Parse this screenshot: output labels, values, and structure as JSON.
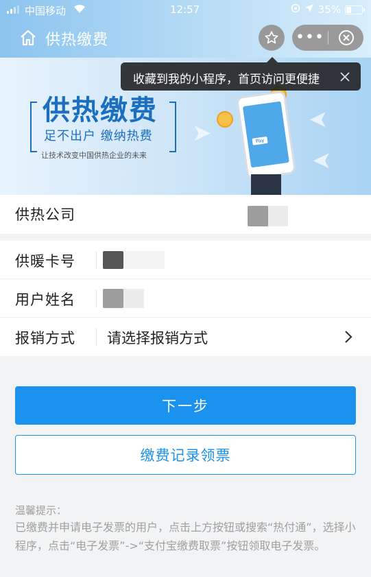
{
  "status_bar": {
    "carrier": "中国移动",
    "time": "12:57",
    "battery": "35%"
  },
  "nav": {
    "title": "供热缴费",
    "more": "•••"
  },
  "tooltip": {
    "text": "收藏到我的小程序，首页访问更便捷"
  },
  "banner": {
    "title": "供热缴费",
    "subtitle": "足不出户  缴纳热费",
    "slogan": "让技术改变中国供热企业的未来",
    "phone_label": "Pay"
  },
  "form": {
    "rows": [
      {
        "label": "供热公司",
        "value": ""
      },
      {
        "label": "供暖卡号",
        "value": ""
      },
      {
        "label": "用户姓名",
        "value": ""
      },
      {
        "label": "报销方式",
        "value": "请选择报销方式"
      }
    ]
  },
  "buttons": {
    "next": "下一步",
    "records": "缴费记录领票"
  },
  "tips": {
    "title": "温馨提示：",
    "body": "已缴费并申请电子发票的用户，点击上方按钮或搜索“热付通”，选择小程序，点击“电子发票”->“支付宝缴费取票”按钮领取电子发票。"
  },
  "colors": {
    "primary": "#1a92ee",
    "tooltip_bg": "#1e1e1e",
    "tip_text": "#a0a0a0"
  }
}
